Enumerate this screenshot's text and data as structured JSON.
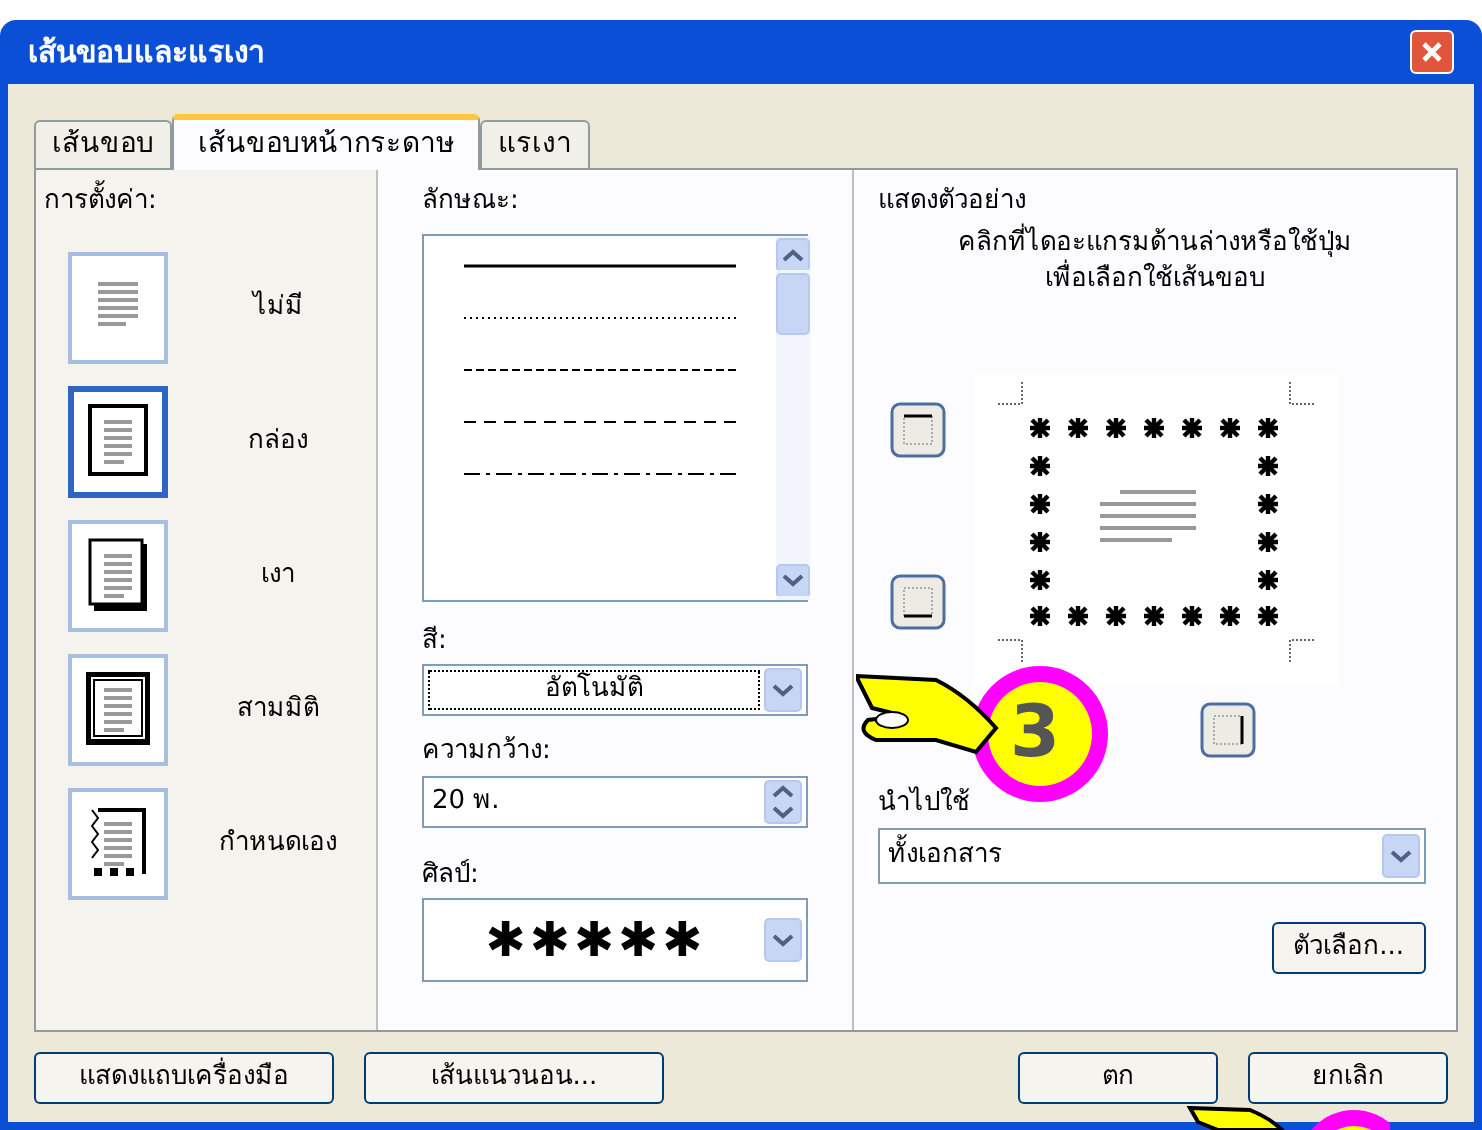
{
  "window": {
    "title": "เส้นขอบและแรเงา"
  },
  "tabs": [
    {
      "label": "เส้นขอบ",
      "selected": false
    },
    {
      "label": "เส้นขอบหน้ากระดาษ",
      "selected": true
    },
    {
      "label": "แรเงา",
      "selected": false
    }
  ],
  "settings": {
    "label": "การตั้งค่า:",
    "items": [
      {
        "label": "ไม่มี",
        "kind": "none",
        "selected": false
      },
      {
        "label": "กล่อง",
        "kind": "box",
        "selected": true
      },
      {
        "label": "เงา",
        "kind": "shadow",
        "selected": false
      },
      {
        "label": "สามมิติ",
        "kind": "threed",
        "selected": false
      },
      {
        "label": "กำหนดเอง",
        "kind": "custom",
        "selected": false
      }
    ]
  },
  "style": {
    "label": "ลักษณะ:",
    "items": [
      {
        "kind": "solid"
      },
      {
        "kind": "dotted"
      },
      {
        "kind": "dashed"
      },
      {
        "kind": "dashed-wide"
      },
      {
        "kind": "dash-dot"
      }
    ]
  },
  "color": {
    "label": "สี:",
    "value": "อัตโนมัติ"
  },
  "width": {
    "label": "ความกว้าง:",
    "value": "20 พ."
  },
  "art": {
    "label": "ศิลป์:",
    "value": "✱✱✱✱✱"
  },
  "preview": {
    "label": "แสดงตัวอย่าง",
    "hint": "คลิกที่ไดอะแกรมด้านล่างหรือใช้ปุ่มเพื่อเลือกใช้เส้นขอบ"
  },
  "apply_to": {
    "label": "นำไปใช้",
    "value": "ทั้งเอกสาร"
  },
  "options_button": "ตัวเลือก...",
  "buttons_left": [
    "แสดงแถบเครื่องมือ",
    "เส้นแนวนอน..."
  ],
  "buttons_right": [
    "ตก",
    "ยกเลิก"
  ],
  "callout": {
    "number": "3"
  }
}
